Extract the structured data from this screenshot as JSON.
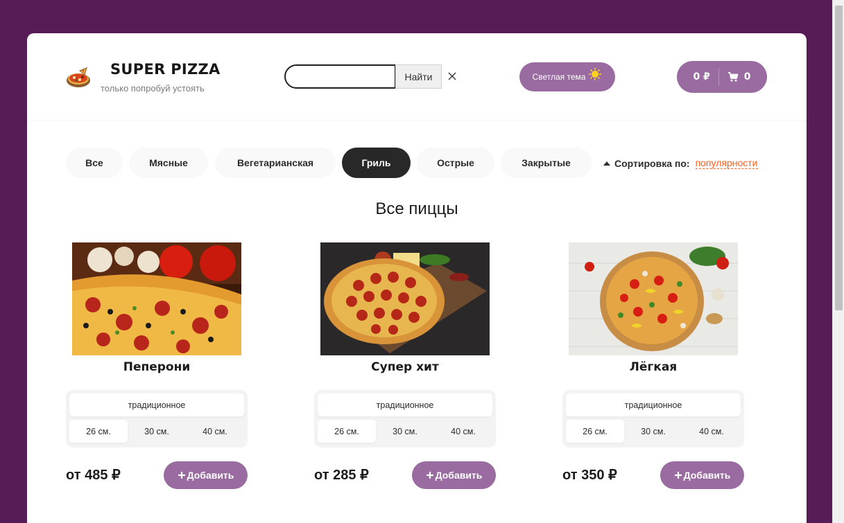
{
  "header": {
    "title": "SUPER PIZZA",
    "subtitle": "только попробуй устоять",
    "search": {
      "value": "",
      "placeholder": "",
      "button_label": "Найти"
    },
    "theme_button_label": "Светлая тема",
    "cart": {
      "sum": "0 ₽",
      "count": "0"
    }
  },
  "categories": [
    "Все",
    "Мясные",
    "Вегетарианская",
    "Гриль",
    "Острые",
    "Закрытые"
  ],
  "active_category": "Гриль",
  "sort": {
    "label": "Сортировка по:",
    "value": "популярности"
  },
  "section_title": "Все пиццы",
  "pizzas": [
    {
      "name": "Пеперони",
      "dough": "традиционное",
      "sizes": [
        "26 см.",
        "30 см.",
        "40 см."
      ],
      "active_size": "26 см.",
      "price": "от 485 ₽",
      "add_label": "Добавить"
    },
    {
      "name": "Супер хит",
      "dough": "традиционное",
      "sizes": [
        "26 см.",
        "30 см.",
        "40 см."
      ],
      "active_size": "26 см.",
      "price": "от 285 ₽",
      "add_label": "Добавить"
    },
    {
      "name": "Лёгкая",
      "dough": "традиционное",
      "sizes": [
        "26 см.",
        "30 см.",
        "40 см."
      ],
      "active_size": "26 см.",
      "price": "от 350 ₽",
      "add_label": "Добавить"
    }
  ],
  "colors": {
    "background": "#571b56",
    "accent": "#9a6ba1",
    "active_category": "#282828",
    "sort_value": "#fe5f1e"
  }
}
